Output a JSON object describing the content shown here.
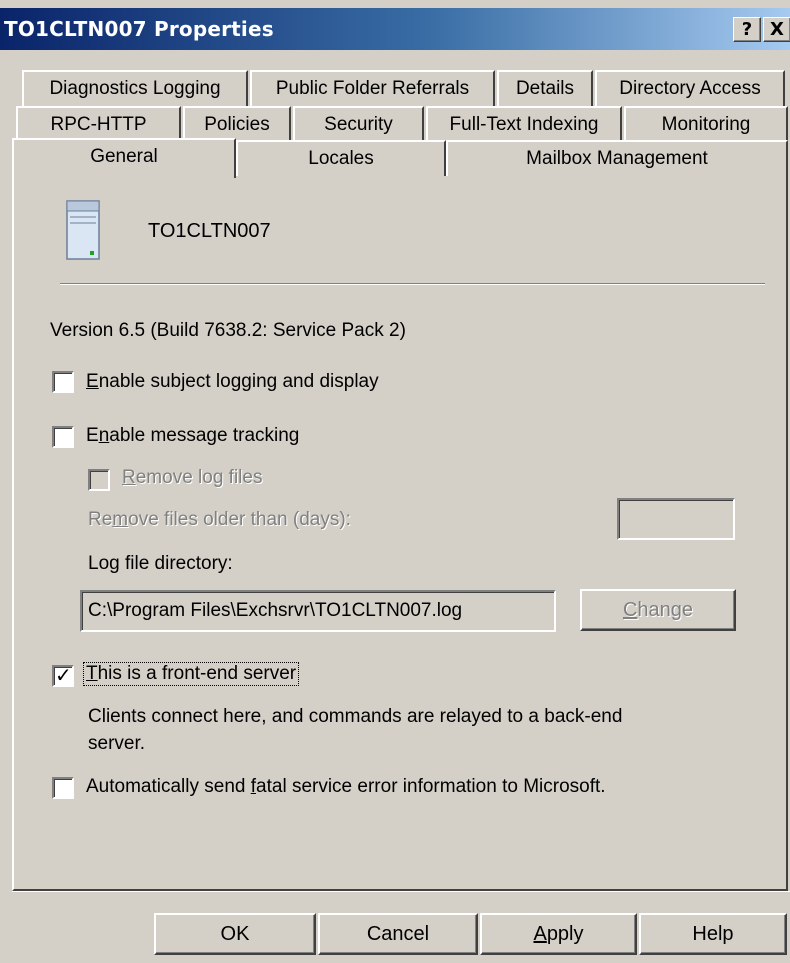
{
  "window": {
    "title": "TO1CLTN007 Properties",
    "help_label": "?",
    "close_label": "X"
  },
  "tabs": {
    "row1": [
      "Diagnostics Logging",
      "Public Folder Referrals",
      "Details",
      "Directory Access"
    ],
    "row2": [
      "RPC-HTTP",
      "Policies",
      "Security",
      "Full-Text Indexing",
      "Monitoring"
    ],
    "row3": [
      "General",
      "Locales",
      "Mailbox Management"
    ],
    "active": "General"
  },
  "general": {
    "server_name": "TO1CLTN007",
    "version": "Version 6.5 (Build 7638.2: Service Pack 2)",
    "subject_logging": {
      "label_u": "E",
      "label_rest": "nable subject logging and display",
      "checked": false
    },
    "message_tracking": {
      "label_pre": "E",
      "label_u": "n",
      "label_rest": "able message tracking",
      "checked": false
    },
    "remove_log_files": {
      "label_u": "R",
      "label_rest": "emove log files",
      "checked": false,
      "enabled": false
    },
    "remove_older": {
      "label_pre": "Re",
      "label_u": "m",
      "label_rest": "ove files older than (days):",
      "value": ""
    },
    "log_dir": {
      "label": "Log file directory:",
      "value": "C:\\Program Files\\Exchsrvr\\TO1CLTN007.log"
    },
    "change_button": {
      "label_u": "C",
      "label_rest": "hange"
    },
    "front_end": {
      "label_u": "T",
      "label_rest": "his is a front-end server",
      "checked": true
    },
    "front_end_desc_1": "Clients connect here, and commands are relayed to a back-end",
    "front_end_desc_2": "server.",
    "auto_send": {
      "label_pre": "Automatically send ",
      "label_u": "f",
      "label_rest": "atal service error information to Microsoft.",
      "checked": false
    }
  },
  "buttons": {
    "ok": "OK",
    "cancel": "Cancel",
    "apply_u": "A",
    "apply_rest": "pply",
    "help": "Help"
  },
  "colors": {
    "face": "#d4d0c8",
    "title_start": "#0a246a",
    "title_end": "#a6caf0",
    "disabled_text": "#808080"
  }
}
